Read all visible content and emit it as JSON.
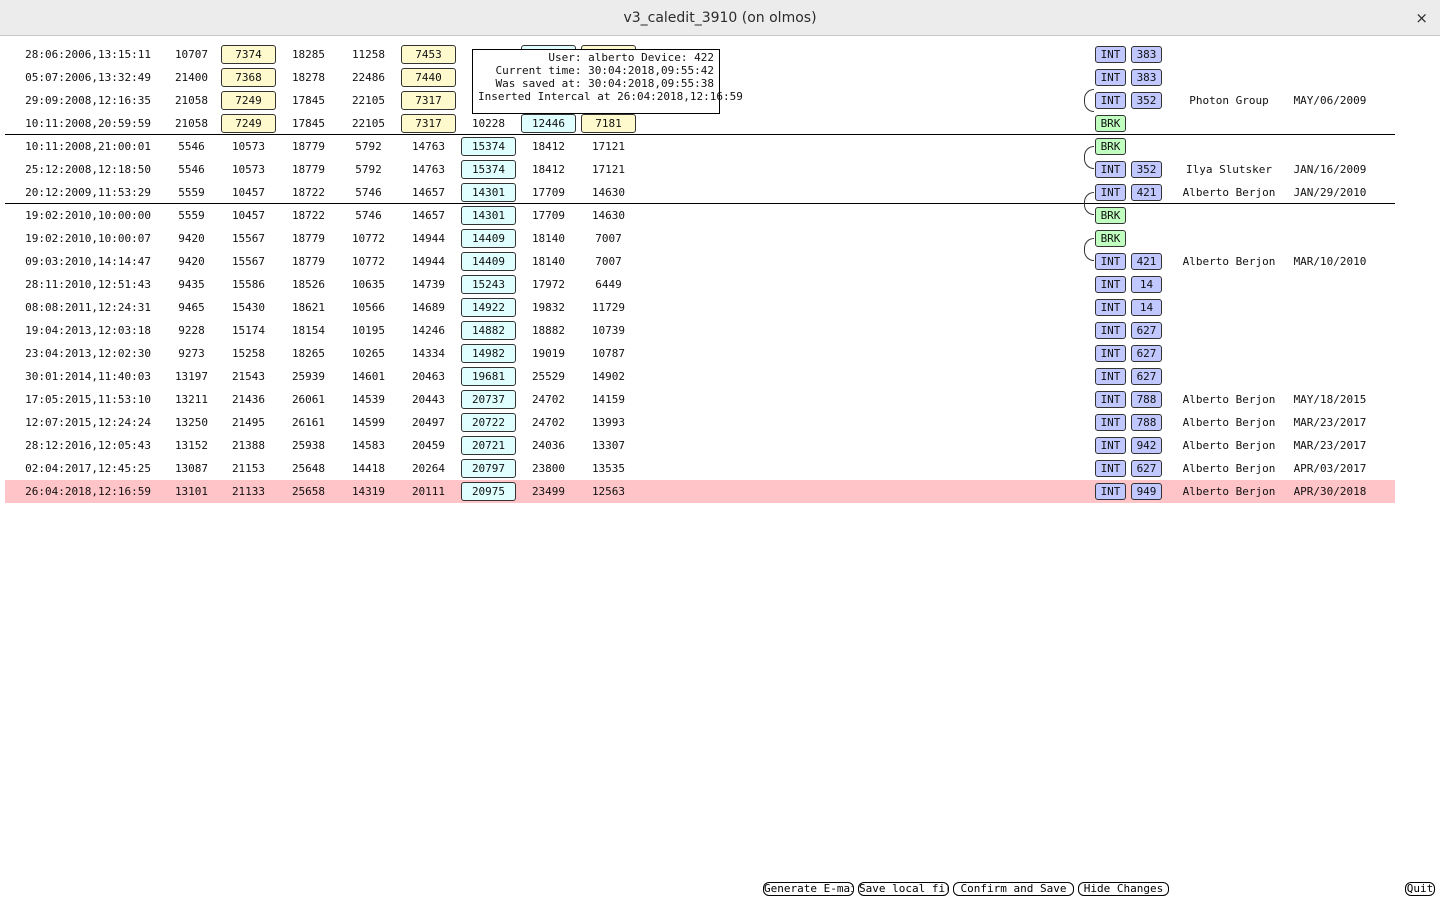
{
  "window": {
    "title": "v3_caledit_3910 (on olmos)",
    "close": "×"
  },
  "tooltip": {
    "lines": [
      "User: alberto Device: 422",
      "Current time: 30:04:2018,09:55:42",
      "Was saved at: 30:04:2018,09:55:38",
      "Inserted Intercal at 26:04:2018,12:16:59"
    ]
  },
  "colors": {
    "highlight_row": "#ffc4c8",
    "yellow_box": "#fffacd",
    "cyan_box": "#e0ffff",
    "int_tag": "#c0c8ff",
    "brk_tag": "#c0ffc0"
  },
  "rows": [
    {
      "date": "28:06:2006,13:15:11",
      "values": [
        "10707",
        "7374",
        "18285",
        "11258",
        "7453",
        "",
        "",
        ""
      ],
      "boxes": [
        "",
        "yellow",
        "",
        "",
        "yellow",
        "",
        "cyan",
        "yellow"
      ],
      "tag": "INT",
      "num": "383",
      "user": "",
      "saved": "",
      "highlight": false
    },
    {
      "date": "05:07:2006,13:32:49",
      "values": [
        "21400",
        "7368",
        "18278",
        "22486",
        "7440",
        "",
        "",
        ""
      ],
      "boxes": [
        "",
        "yellow",
        "",
        "",
        "yellow",
        "",
        "",
        ""
      ],
      "tag": "INT",
      "num": "383",
      "user": "",
      "saved": "",
      "highlight": false
    },
    {
      "date": "29:09:2008,12:16:35",
      "values": [
        "21058",
        "7249",
        "17845",
        "22105",
        "7317",
        "",
        "",
        ""
      ],
      "boxes": [
        "",
        "yellow",
        "",
        "",
        "yellow",
        "",
        "",
        ""
      ],
      "tag": "INT",
      "num": "352",
      "user": "Photon Group",
      "saved": "MAY/06/2009",
      "highlight": false
    },
    {
      "date": "10:11:2008,20:59:59",
      "values": [
        "21058",
        "7249",
        "17845",
        "22105",
        "7317",
        "10228",
        "12446",
        "7181"
      ],
      "boxes": [
        "",
        "yellow",
        "",
        "",
        "yellow",
        "",
        "cyan",
        "yellow"
      ],
      "tag": "BRK",
      "num": "",
      "user": "",
      "saved": "",
      "highlight": false
    },
    {
      "date": "10:11:2008,21:00:01",
      "values": [
        "5546",
        "10573",
        "18779",
        "5792",
        "14763",
        "15374",
        "18412",
        "17121"
      ],
      "boxes": [
        "",
        "",
        "",
        "",
        "",
        "cyan",
        "",
        ""
      ],
      "tag": "BRK",
      "num": "",
      "user": "",
      "saved": "",
      "highlight": false
    },
    {
      "date": "25:12:2008,12:18:50",
      "values": [
        "5546",
        "10573",
        "18779",
        "5792",
        "14763",
        "15374",
        "18412",
        "17121"
      ],
      "boxes": [
        "",
        "",
        "",
        "",
        "",
        "cyan",
        "",
        ""
      ],
      "tag": "INT",
      "num": "352",
      "user": "Ilya Slutsker",
      "saved": "JAN/16/2009",
      "highlight": false
    },
    {
      "date": "20:12:2009,11:53:29",
      "values": [
        "5559",
        "10457",
        "18722",
        "5746",
        "14657",
        "14301",
        "17709",
        "14630"
      ],
      "boxes": [
        "",
        "",
        "",
        "",
        "",
        "cyan",
        "",
        ""
      ],
      "tag": "INT",
      "num": "421",
      "user": "Alberto Berjon",
      "saved": "JAN/29/2010",
      "highlight": false
    },
    {
      "date": "19:02:2010,10:00:00",
      "values": [
        "5559",
        "10457",
        "18722",
        "5746",
        "14657",
        "14301",
        "17709",
        "14630"
      ],
      "boxes": [
        "",
        "",
        "",
        "",
        "",
        "cyan",
        "",
        ""
      ],
      "tag": "BRK",
      "num": "",
      "user": "",
      "saved": "",
      "highlight": false
    },
    {
      "date": "19:02:2010,10:00:07",
      "values": [
        "9420",
        "15567",
        "18779",
        "10772",
        "14944",
        "14409",
        "18140",
        "7007"
      ],
      "boxes": [
        "",
        "",
        "",
        "",
        "",
        "cyan",
        "",
        ""
      ],
      "tag": "BRK",
      "num": "",
      "user": "",
      "saved": "",
      "highlight": false
    },
    {
      "date": "09:03:2010,14:14:47",
      "values": [
        "9420",
        "15567",
        "18779",
        "10772",
        "14944",
        "14409",
        "18140",
        "7007"
      ],
      "boxes": [
        "",
        "",
        "",
        "",
        "",
        "cyan",
        "",
        ""
      ],
      "tag": "INT",
      "num": "421",
      "user": "Alberto Berjon",
      "saved": "MAR/10/2010",
      "highlight": false
    },
    {
      "date": "28:11:2010,12:51:43",
      "values": [
        "9435",
        "15586",
        "18526",
        "10635",
        "14739",
        "15243",
        "17972",
        "6449"
      ],
      "boxes": [
        "",
        "",
        "",
        "",
        "",
        "cyan",
        "",
        ""
      ],
      "tag": "INT",
      "num": "14",
      "user": "",
      "saved": "",
      "highlight": false
    },
    {
      "date": "08:08:2011,12:24:31",
      "values": [
        "9465",
        "15430",
        "18621",
        "10566",
        "14689",
        "14922",
        "19832",
        "11729"
      ],
      "boxes": [
        "",
        "",
        "",
        "",
        "",
        "cyan",
        "",
        ""
      ],
      "tag": "INT",
      "num": "14",
      "user": "",
      "saved": "",
      "highlight": false
    },
    {
      "date": "19:04:2013,12:03:18",
      "values": [
        "9228",
        "15174",
        "18154",
        "10195",
        "14246",
        "14882",
        "18882",
        "10739"
      ],
      "boxes": [
        "",
        "",
        "",
        "",
        "",
        "cyan",
        "",
        ""
      ],
      "tag": "INT",
      "num": "627",
      "user": "",
      "saved": "",
      "highlight": false
    },
    {
      "date": "23:04:2013,12:02:30",
      "values": [
        "9273",
        "15258",
        "18265",
        "10265",
        "14334",
        "14982",
        "19019",
        "10787"
      ],
      "boxes": [
        "",
        "",
        "",
        "",
        "",
        "cyan",
        "",
        ""
      ],
      "tag": "INT",
      "num": "627",
      "user": "",
      "saved": "",
      "highlight": false
    },
    {
      "date": "30:01:2014,11:40:03",
      "values": [
        "13197",
        "21543",
        "25939",
        "14601",
        "20463",
        "19681",
        "25529",
        "14902"
      ],
      "boxes": [
        "",
        "",
        "",
        "",
        "",
        "cyan",
        "",
        ""
      ],
      "tag": "INT",
      "num": "627",
      "user": "",
      "saved": "",
      "highlight": false
    },
    {
      "date": "17:05:2015,11:53:10",
      "values": [
        "13211",
        "21436",
        "26061",
        "14539",
        "20443",
        "20737",
        "24702",
        "14159"
      ],
      "boxes": [
        "",
        "",
        "",
        "",
        "",
        "cyan",
        "",
        ""
      ],
      "tag": "INT",
      "num": "788",
      "user": "Alberto Berjon",
      "saved": "MAY/18/2015",
      "highlight": false
    },
    {
      "date": "12:07:2015,12:24:24",
      "values": [
        "13250",
        "21495",
        "26161",
        "14599",
        "20497",
        "20722",
        "24702",
        "13993"
      ],
      "boxes": [
        "",
        "",
        "",
        "",
        "",
        "cyan",
        "",
        ""
      ],
      "tag": "INT",
      "num": "788",
      "user": "Alberto Berjon",
      "saved": "MAR/23/2017",
      "highlight": false
    },
    {
      "date": "28:12:2016,12:05:43",
      "values": [
        "13152",
        "21388",
        "25938",
        "14583",
        "20459",
        "20721",
        "24036",
        "13307"
      ],
      "boxes": [
        "",
        "",
        "",
        "",
        "",
        "cyan",
        "",
        ""
      ],
      "tag": "INT",
      "num": "942",
      "user": "Alberto Berjon",
      "saved": "MAR/23/2017",
      "highlight": false
    },
    {
      "date": "02:04:2017,12:45:25",
      "values": [
        "13087",
        "21153",
        "25648",
        "14418",
        "20264",
        "20797",
        "23800",
        "13535"
      ],
      "boxes": [
        "",
        "",
        "",
        "",
        "",
        "cyan",
        "",
        ""
      ],
      "tag": "INT",
      "num": "627",
      "user": "Alberto Berjon",
      "saved": "APR/03/2017",
      "highlight": false
    },
    {
      "date": "26:04:2018,12:16:59",
      "values": [
        "13101",
        "21133",
        "25658",
        "14319",
        "20111",
        "20975",
        "23499",
        "12563"
      ],
      "boxes": [
        "",
        "",
        "",
        "",
        "",
        "cyan",
        "",
        ""
      ],
      "tag": "INT",
      "num": "949",
      "user": "Alberto Berjon",
      "saved": "APR/30/2018",
      "highlight": true
    }
  ],
  "buttons": {
    "email": "Generate E-mail",
    "save_local": "Save local file",
    "confirm": "Confirm and Save",
    "hide": "Hide Changes",
    "quit": "Quit"
  }
}
